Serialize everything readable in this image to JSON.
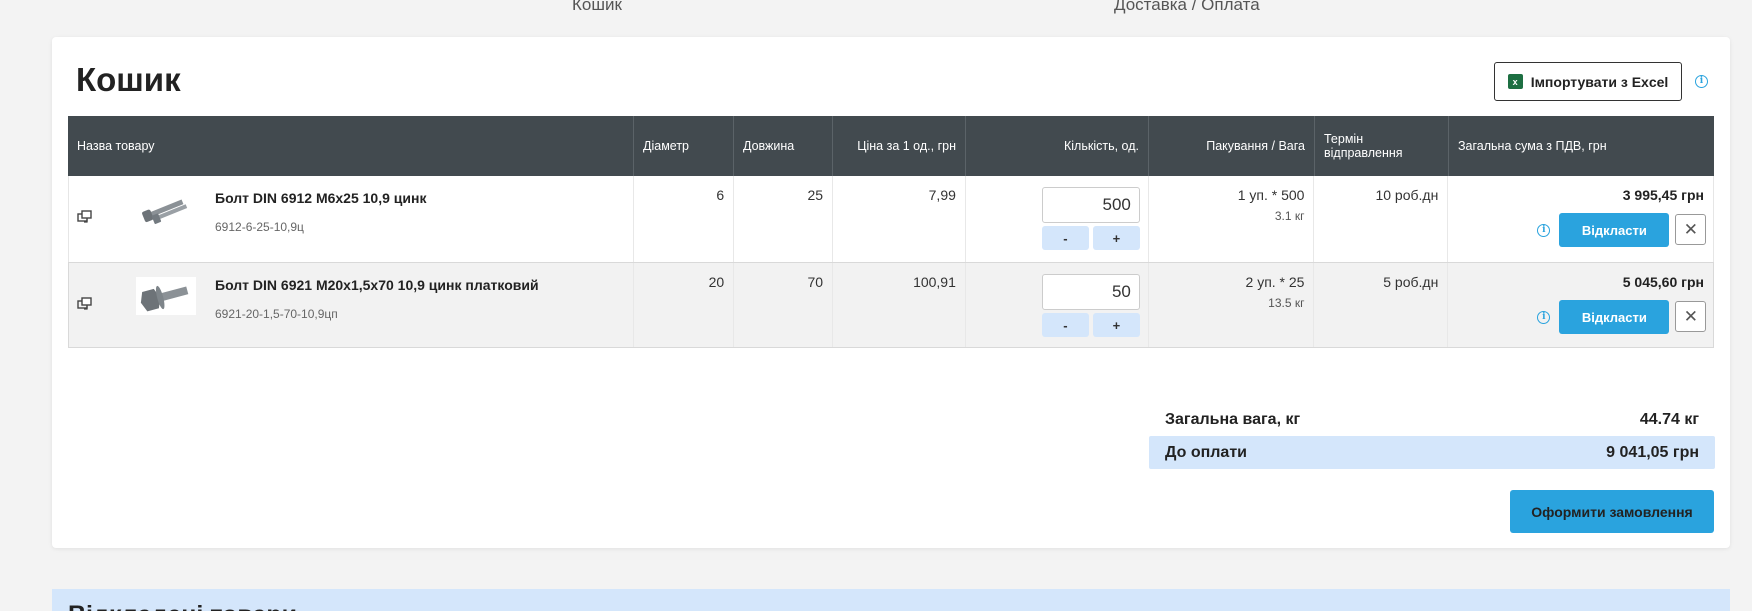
{
  "steps": [
    "Кошик",
    "Доставка / Оплата"
  ],
  "cart": {
    "title": "Кошик",
    "import_label": "Імпортувати з Excel",
    "import_icon": "excel-icon",
    "columns": {
      "name": "Назва товару",
      "diameter": "Діаметр",
      "length": "Довжина",
      "price": "Ціна за 1 од., грн",
      "qty": "Кількість, од.",
      "pack": "Пакування / Вага",
      "term": "Термін відправлення",
      "total": "Загальна сума з ПДВ, грн"
    },
    "items": [
      {
        "name": "Болт DIN 6912 M6x25 10,9 цинк",
        "sku": "6912-6-25-10,9ц",
        "diameter": "6",
        "length": "25",
        "price": "7,99",
        "qty": "500",
        "pack": "1 уп. * 500",
        "weight": "3.1 кг",
        "term": "10 роб.дн",
        "total": "3 995,45 грн"
      },
      {
        "name": "Болт DIN 6921 M20x1,5x70 10,9 цинк платковий",
        "sku": "6921-20-1,5-70-10,9цп",
        "diameter": "20",
        "length": "70",
        "price": "100,91",
        "qty": "50",
        "pack": "2 уп. * 25",
        "weight": "13.5 кг",
        "term": "5 роб.дн",
        "total": "5 045,60 грн"
      }
    ],
    "minus_label": "-",
    "plus_label": "+",
    "postpone_label": "Відкласти",
    "remove_label": "✕",
    "summary": {
      "weight_label": "Загальна вага, кг",
      "weight_value": "44.74 кг",
      "pay_label": "До оплати",
      "pay_value": "9 041,05 грн"
    },
    "checkout_label": "Оформити замовлення"
  },
  "postponed": {
    "title": "Відкладені товари"
  },
  "colors": {
    "accent": "#2aa3de",
    "header_bg": "#424a4f",
    "light_blue": "#d4e6fb"
  }
}
